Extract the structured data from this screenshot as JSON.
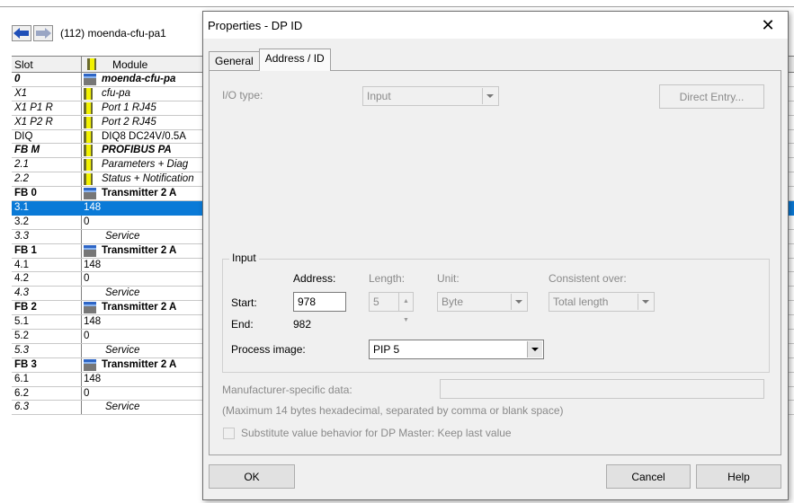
{
  "station": {
    "title": "(112)  moenda-cfu-pa1",
    "headers": {
      "slot": "Slot",
      "module": "Module"
    },
    "rows": [
      {
        "slot": "0",
        "module": "moenda-cfu-pa",
        "style": "boldital",
        "icon": "dev"
      },
      {
        "slot": "X1",
        "module": "cfu-pa",
        "style": "italic",
        "icon": "bar"
      },
      {
        "slot": "X1 P1 R",
        "module": "Port 1 RJ45",
        "style": "italic",
        "icon": "bar"
      },
      {
        "slot": "X1 P2 R",
        "module": "Port 2 RJ45",
        "style": "italic",
        "icon": "bar"
      },
      {
        "slot": "DIQ",
        "module": "DIQ8 DC24V/0.5A",
        "style": "normal",
        "icon": "bar"
      },
      {
        "slot": "FB M",
        "module": "PROFIBUS PA",
        "style": "boldital",
        "icon": "bar"
      },
      {
        "slot": "2.1",
        "module": "Parameters + Diag",
        "style": "italic",
        "icon": "bar"
      },
      {
        "slot": "2.2",
        "module": "Status + Notification",
        "style": "italic",
        "icon": "bar"
      },
      {
        "slot": "FB 0",
        "module": "Transmitter 2 A",
        "style": "bold",
        "icon": "dev"
      },
      {
        "slot": "3.1",
        "module": "148",
        "style": "selected"
      },
      {
        "slot": "3.2",
        "module": "0",
        "style": "normal"
      },
      {
        "slot": "3.3",
        "module": "Service",
        "style": "italic-indent"
      },
      {
        "slot": "FB 1",
        "module": "Transmitter 2 A",
        "style": "bold",
        "icon": "dev"
      },
      {
        "slot": "4.1",
        "module": "148",
        "style": "normal"
      },
      {
        "slot": "4.2",
        "module": "0",
        "style": "normal"
      },
      {
        "slot": "4.3",
        "module": "Service",
        "style": "italic-indent"
      },
      {
        "slot": "FB 2",
        "module": "Transmitter 2 A",
        "style": "bold",
        "icon": "dev"
      },
      {
        "slot": "5.1",
        "module": "148",
        "style": "normal"
      },
      {
        "slot": "5.2",
        "module": "0",
        "style": "normal"
      },
      {
        "slot": "5.3",
        "module": "Service",
        "style": "italic-indent"
      },
      {
        "slot": "FB 3",
        "module": "Transmitter 2 A",
        "style": "bold",
        "icon": "dev"
      },
      {
        "slot": "6.1",
        "module": "148",
        "style": "normal"
      },
      {
        "slot": "6.2",
        "module": "0",
        "style": "normal"
      },
      {
        "slot": "6.3",
        "module": "Service",
        "style": "italic-indent"
      }
    ]
  },
  "dialog": {
    "title": "Properties - DP ID",
    "close": "✕",
    "tabs": [
      "General",
      "Address / ID"
    ],
    "io_type_label": "I/O type:",
    "io_type_value": "Input",
    "direct_entry": "Direct Entry...",
    "group_title": "Input",
    "col_address": "Address:",
    "col_length": "Length:",
    "col_unit": "Unit:",
    "col_consistent": "Consistent over:",
    "start_label": "Start:",
    "start_value": "978",
    "length_value": "5",
    "unit_value": "Byte",
    "consistent_value": "Total length",
    "end_label": "End:",
    "end_value": "982",
    "process_image_label": "Process image:",
    "process_image_value": "PIP 5",
    "manufacturer_label": "Manufacturer-specific data:",
    "manufacturer_value": "",
    "hint": "(Maximum 14 bytes hexadecimal, separated by comma or blank space)",
    "substitute_label": "Substitute value behavior for DP Master: Keep last value",
    "ok": "OK",
    "cancel": "Cancel",
    "help": "Help"
  },
  "colors": {
    "selection": "#0a7ad7",
    "dialog_bg": "#f0f0f0"
  }
}
